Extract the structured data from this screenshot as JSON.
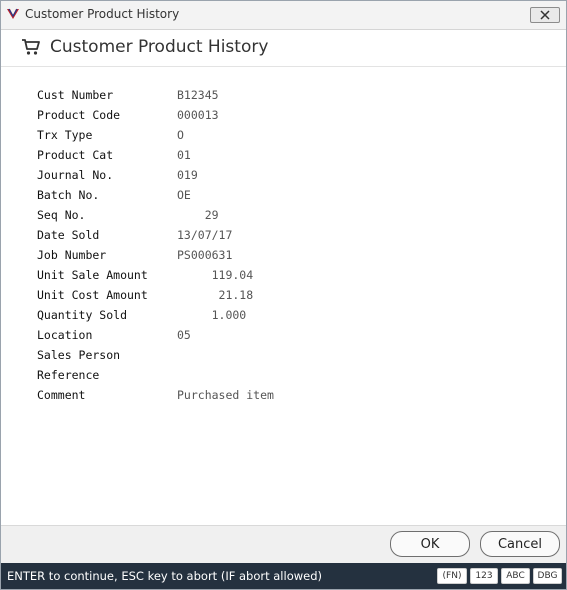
{
  "window": {
    "title": "Customer Product History"
  },
  "header": {
    "title": "Customer Product History",
    "icon": "cart-icon"
  },
  "fields": [
    {
      "label": "Cust Number",
      "value": "B12345"
    },
    {
      "label": "Product Code",
      "value": "000013"
    },
    {
      "label": "Trx Type",
      "value": "O"
    },
    {
      "label": "Product Cat",
      "value": "01"
    },
    {
      "label": "Journal No.",
      "value": "019"
    },
    {
      "label": "Batch No.",
      "value": "OE"
    },
    {
      "label": "Seq No.",
      "value": "    29"
    },
    {
      "label": "Date Sold",
      "value": "13/07/17"
    },
    {
      "label": "Job Number",
      "value": "PS000631"
    },
    {
      "label": "Unit Sale Amount",
      "value": "     119.04"
    },
    {
      "label": "Unit Cost Amount",
      "value": "      21.18"
    },
    {
      "label": "Quantity Sold",
      "value": "     1.000"
    },
    {
      "label": "Location",
      "value": "05"
    },
    {
      "label": "Sales Person",
      "value": ""
    },
    {
      "label": "Reference",
      "value": ""
    },
    {
      "label": "Comment",
      "value": "Purchased item"
    }
  ],
  "buttons": {
    "ok": "OK",
    "cancel": "Cancel"
  },
  "status": {
    "text": "ENTER to continue, ESC key to abort (IF abort allowed)",
    "badges": [
      "(FN)",
      "123",
      "ABC",
      "DBG"
    ]
  },
  "colors": {
    "status_bg": "#24313f",
    "logo_red": "#c0202a",
    "logo_blue": "#1f3a8a"
  }
}
